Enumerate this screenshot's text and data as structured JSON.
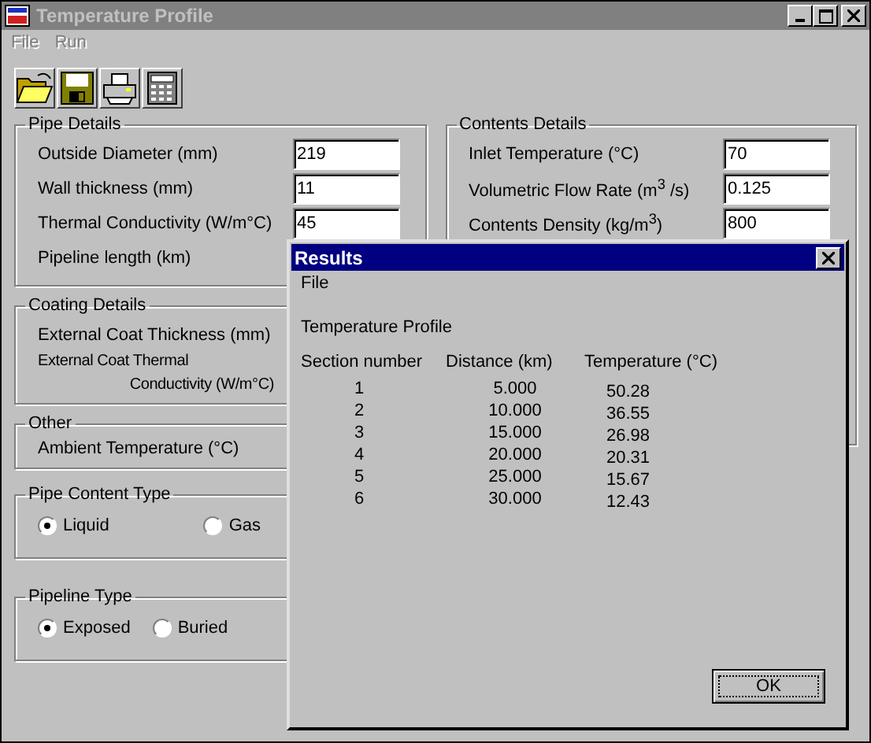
{
  "window": {
    "title": "Temperature Profile"
  },
  "menu": [
    "File",
    "Run"
  ],
  "pipe_details": {
    "title": "Pipe Details",
    "fields": [
      {
        "label": "Outside Diameter (mm)",
        "value": "219"
      },
      {
        "label": "Wall thickness (mm)",
        "value": "11"
      },
      {
        "label": "Thermal Conductivity (W/m°C)",
        "value": "45"
      },
      {
        "label": "Pipeline length (km)"
      }
    ]
  },
  "coating_details": {
    "title": "Coating Details",
    "fields": [
      {
        "label": "External Coat Thickness (mm)"
      },
      {
        "label": "External Coat Thermal Conductivity (W/m°C)"
      }
    ]
  },
  "other": {
    "title": "Other",
    "fields": [
      {
        "label": "Ambient Temperature (°C)"
      }
    ]
  },
  "pipe_content_type": {
    "title": "Pipe Content Type",
    "options": [
      {
        "label": "Liquid",
        "selected": true
      },
      {
        "label": "Gas",
        "selected": false
      }
    ]
  },
  "pipeline_type": {
    "title": "Pipeline Type",
    "options": [
      {
        "label": "Exposed",
        "selected": true
      },
      {
        "label": "Buried",
        "selected": false
      }
    ]
  },
  "contents_details": {
    "title": "Contents Details",
    "fields": [
      {
        "label": "Inlet Temperature (°C)",
        "value": "70"
      },
      {
        "label": "Volumetric Flow Rate (m$^{3}$ /s)",
        "value": "0.125"
      },
      {
        "label": "Contents Density (kg/m$^{3}$)",
        "value": "800"
      }
    ]
  },
  "results": {
    "title": "Results",
    "menu": [
      "File"
    ],
    "heading": "Temperature Profile",
    "columns": [
      "Section number",
      "Distance (km)",
      "Temperature (°C)"
    ],
    "rows": [
      [
        "1",
        "5.000",
        "50.28"
      ],
      [
        "2",
        "10.000",
        "36.55"
      ],
      [
        "3",
        "15.000",
        "26.98"
      ],
      [
        "4",
        "20.000",
        "20.31"
      ],
      [
        "5",
        "25.000",
        "15.67"
      ],
      [
        "6",
        "30.000",
        "12.43"
      ]
    ],
    "ok_button": "OK"
  }
}
